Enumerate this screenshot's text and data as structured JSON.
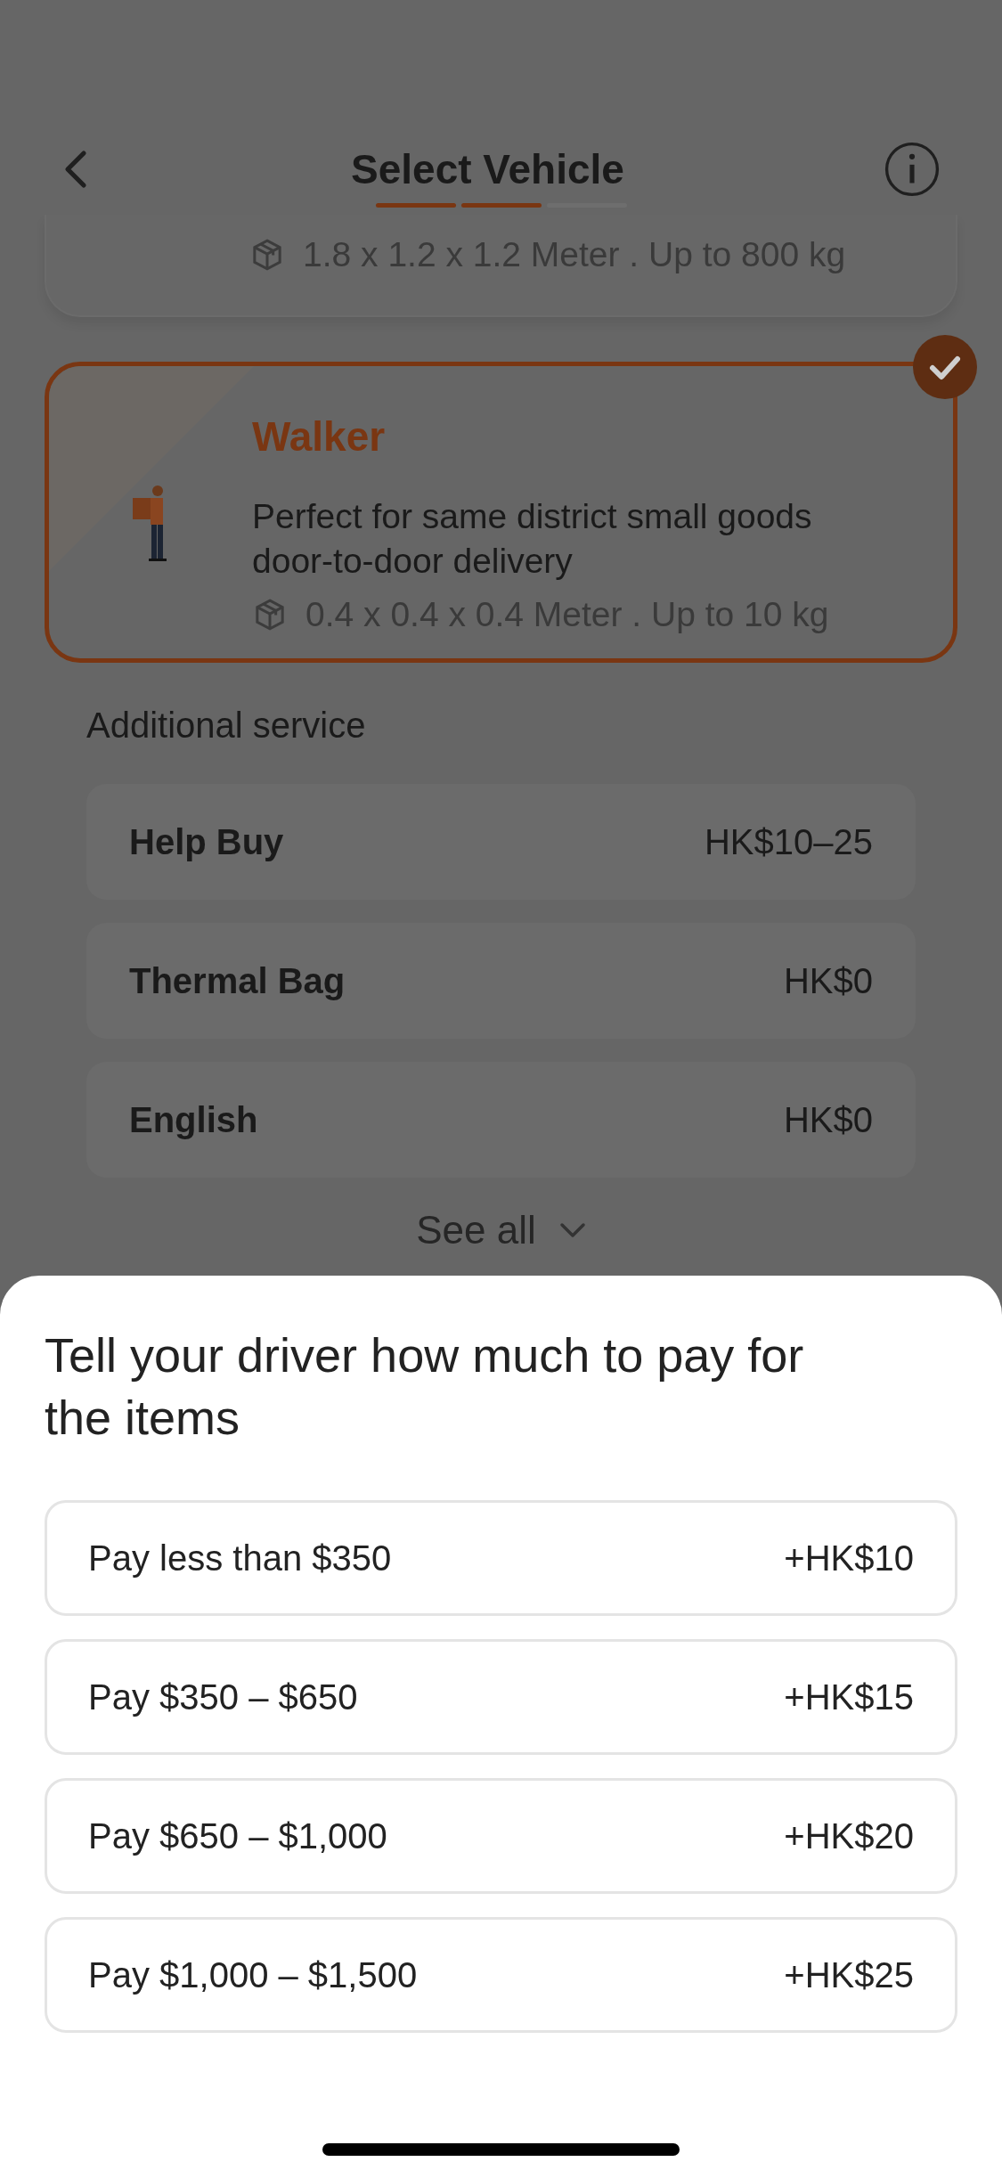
{
  "header": {
    "title": "Select Vehicle",
    "progress": [
      {
        "done": true
      },
      {
        "done": true
      },
      {
        "done": false
      }
    ]
  },
  "vehicles": [
    {
      "selected": false,
      "dimensions": "1.8 x 1.2 x 1.2 Meter . Up to 800 kg"
    },
    {
      "selected": true,
      "name": "Walker",
      "description": "Perfect for same district small goods door-to-door delivery",
      "dimensions": "0.4 x 0.4 x 0.4 Meter . Up to 10 kg"
    }
  ],
  "additional_service": {
    "title": "Additional service",
    "items": [
      {
        "label": "Help Buy",
        "price": "HK$10–25"
      },
      {
        "label": "Thermal Bag",
        "price": "HK$0"
      },
      {
        "label": "English",
        "price": "HK$0"
      }
    ],
    "see_all": "See all"
  },
  "sheet": {
    "title": "Tell your driver how much to pay for the items",
    "options": [
      {
        "label": "Pay less than $350",
        "price": "+HK$10"
      },
      {
        "label": "Pay $350 – $650",
        "price": "+HK$15"
      },
      {
        "label": "Pay $650 – $1,000",
        "price": "+HK$20"
      },
      {
        "label": "Pay $1,000 – $1,500",
        "price": "+HK$25"
      }
    ]
  }
}
